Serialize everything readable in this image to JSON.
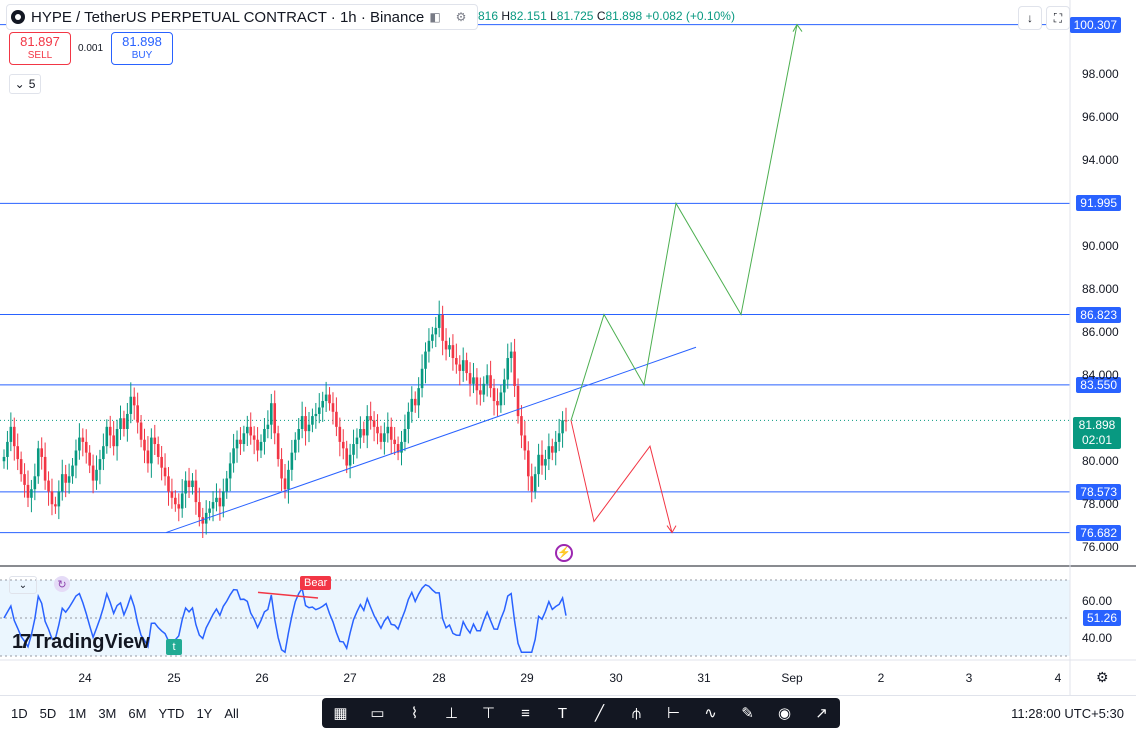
{
  "header": {
    "symbol": "HYPE / TetherUS PERPETUAL CONTRACT · 1h · Binance",
    "ohlc": {
      "o_label": "",
      "o_value": "816",
      "h_label": "H",
      "h_value": "82.151",
      "l_label": "L",
      "l_value": "81.725",
      "c_label": "C",
      "c_value": "81.898",
      "change": "+0.082 (+0.10%)"
    }
  },
  "trade": {
    "sell_price": "81.897",
    "sell_label": "SELL",
    "spread": "0.001",
    "buy_price": "81.898",
    "buy_label": "BUY",
    "collapse_count": "5"
  },
  "price_axis": {
    "ticks": [
      "98.000",
      "96.000",
      "94.000",
      "90.000",
      "88.000",
      "86.000",
      "84.000",
      "80.000",
      "78.000",
      "76.000"
    ],
    "levels": [
      "100.307",
      "91.995",
      "86.823",
      "83.550",
      "78.573",
      "76.682"
    ],
    "last_price": "81.898",
    "countdown": "02:01"
  },
  "time_axis": {
    "labels": [
      "24",
      "25",
      "26",
      "27",
      "28",
      "29",
      "30",
      "31",
      "Sep",
      "2",
      "3",
      "4"
    ]
  },
  "indicator": {
    "axis_ticks": [
      "60.00",
      "40.00"
    ],
    "value": "51.26",
    "bear_label": "Bear",
    "badge": "t"
  },
  "branding": {
    "logo_text": "TradingView",
    "logo_mark": "17"
  },
  "toolbar": {
    "ranges": [
      "1D",
      "5D",
      "1M",
      "3M",
      "6M",
      "YTD",
      "1Y",
      "All"
    ],
    "tools": [
      "calendar-icon",
      "rectangle-icon",
      "zigzag-icon",
      "long-position-icon",
      "short-position-icon",
      "fib-icon",
      "text-icon",
      "line-icon",
      "pitchfork-icon",
      "volume-profile-icon",
      "path-icon",
      "brush-icon",
      "eye-icon",
      "arrow-icon"
    ],
    "clock": "11:28:00 UTC+5:30"
  },
  "colors": {
    "up": "#089981",
    "down": "#f23645",
    "level": "#2962ff",
    "projection_up": "#4caf50",
    "projection_down": "#f23645",
    "rsi": "#2962ff"
  },
  "chart_data": {
    "type": "candlestick",
    "title": "HYPE / TetherUS PERPETUAL CONTRACT · 1h · Binance",
    "ylim": [
      75.5,
      100.8
    ],
    "x_day_labels": [
      "24",
      "25",
      "26",
      "27",
      "28",
      "29",
      "30",
      "31",
      "Sep",
      "2",
      "3",
      "4"
    ],
    "closes": [
      80.2,
      80.9,
      81.6,
      80.7,
      80.1,
      79.4,
      78.9,
      78.3,
      78.7,
      79.3,
      80.6,
      80.2,
      79.1,
      78.6,
      78.0,
      77.9,
      78.6,
      79.4,
      79.0,
      79.3,
      79.8,
      80.5,
      81.1,
      80.9,
      80.4,
      79.8,
      79.1,
      79.6,
      80.1,
      80.7,
      81.6,
      81.2,
      80.7,
      81.5,
      82.0,
      81.5,
      82.2,
      83.0,
      82.6,
      81.8,
      81.0,
      80.5,
      79.9,
      81.1,
      80.8,
      80.2,
      79.7,
      79.3,
      78.6,
      78.3,
      78.0,
      77.8,
      78.5,
      79.1,
      78.8,
      79.1,
      78.1,
      77.4,
      77.1,
      77.6,
      77.8,
      78.1,
      78.3,
      77.9,
      78.6,
      79.2,
      79.9,
      80.6,
      81.0,
      80.8,
      81.3,
      81.6,
      81.2,
      81.0,
      80.5,
      80.9,
      81.5,
      81.7,
      82.7,
      81.3,
      80.1,
      79.2,
      78.7,
      79.6,
      80.4,
      81.0,
      81.5,
      82.1,
      81.4,
      81.7,
      82.1,
      82.2,
      82.5,
      82.8,
      83.1,
      82.7,
      82.3,
      81.6,
      80.9,
      80.6,
      79.8,
      80.3,
      80.8,
      81.1,
      81.5,
      81.2,
      82.1,
      81.9,
      81.6,
      81.3,
      80.9,
      81.3,
      81.6,
      81.0,
      80.8,
      80.4,
      80.9,
      81.5,
      82.3,
      82.9,
      82.6,
      83.4,
      84.3,
      85.1,
      85.6,
      85.9,
      86.2,
      86.8,
      85.6,
      85.2,
      85.4,
      84.8,
      84.5,
      84.2,
      84.7,
      84.1,
      83.6,
      83.9,
      83.3,
      83.1,
      83.6,
      84.0,
      83.4,
      82.8,
      82.6,
      83.2,
      83.8,
      84.8,
      85.1,
      83.5,
      82.1,
      81.2,
      80.5,
      79.3,
      78.6,
      79.4,
      80.3,
      79.8,
      80.1,
      80.7,
      80.4,
      80.9,
      81.3,
      81.9,
      81.898
    ],
    "levels": [
      100.307,
      91.995,
      86.823,
      83.55,
      78.573,
      76.682
    ],
    "last_price": 81.898,
    "trendline": {
      "from": {
        "day": "25",
        "price": 76.682
      },
      "to_price": 85.3
    },
    "projection_up": [
      81.898,
      86.823,
      83.55,
      91.995,
      86.823,
      100.307
    ],
    "projection_down": [
      81.898,
      77.2,
      80.7,
      76.682
    ],
    "rsi_last": 51.26,
    "rsi_ticks": [
      60,
      40
    ]
  }
}
